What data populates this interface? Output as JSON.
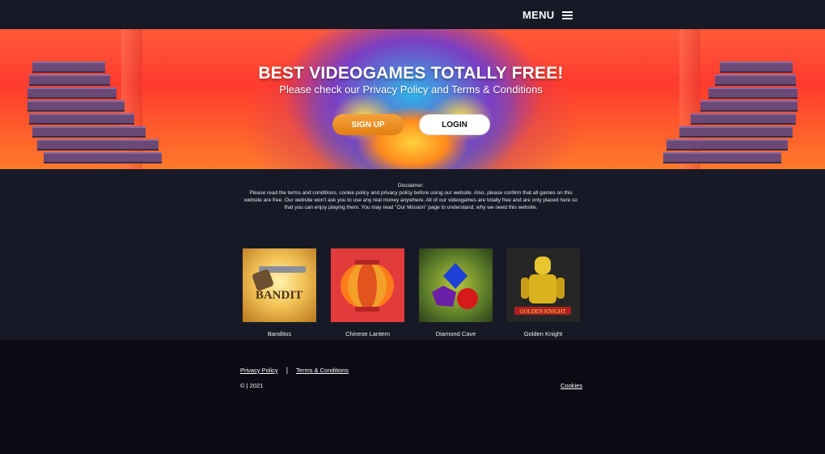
{
  "header": {
    "menu_label": "MENU",
    "menu_icon": "hamburger-icon"
  },
  "hero": {
    "title": "BEST VIDEOGAMES TOTALLY FREE!",
    "subtitle": "Please check our Privacy Policy and Terms & Conditions",
    "signup_label": "SIGN UP",
    "login_label": "LOGIN"
  },
  "disclaimer": {
    "title": "Disclaimer:",
    "text": "Please read the terms and conditions, cookie policy and privacy policy before using our website. Also, please confirm that all games on this website are free. Our website won't ask you to use any real money anywhere. All of our videogames are totally free and are only placed here so that you can enjoy playing them. You may read \"Our Mission\" page to understand, why we need this website."
  },
  "games": [
    {
      "name": "Banditos"
    },
    {
      "name": "Chinese Lantern"
    },
    {
      "name": "Diamond Cave"
    },
    {
      "name": "Golden Knight"
    }
  ],
  "footer": {
    "privacy_label": "Privacy Policy",
    "separator": "|",
    "terms_label": "Terms & Conditions",
    "copyright": "© | 2021",
    "cookies_label": "Cookies"
  },
  "colors": {
    "background": "#171a26",
    "footer": "#0c0a13",
    "signup": "#e8891a"
  }
}
